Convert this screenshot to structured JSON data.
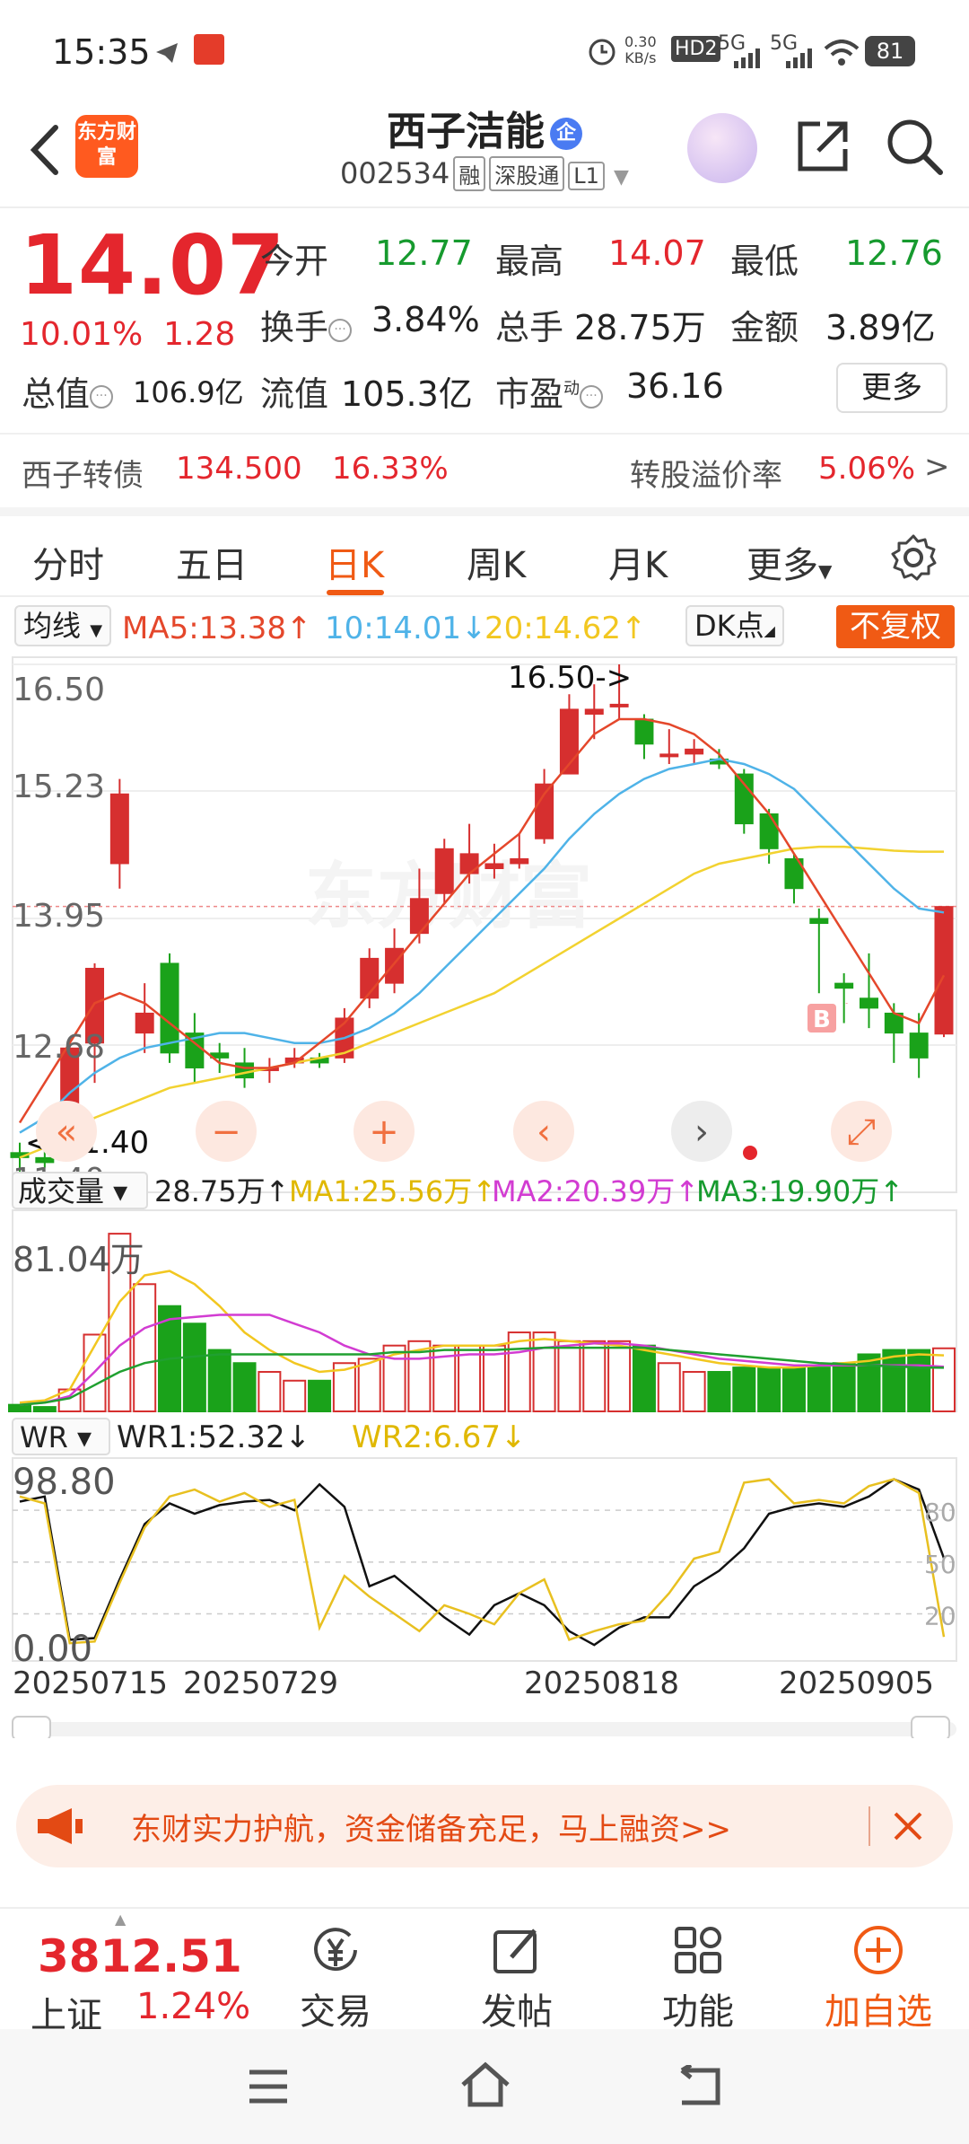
{
  "status_bar": {
    "time": "15:35",
    "net_speed_top": "0.30",
    "net_speed_unit": "KB/s",
    "hd": "HD2",
    "sig1": "5G",
    "sig2": "5G",
    "battery": "81"
  },
  "header": {
    "stock_name": "西子洁能",
    "badge": "企",
    "code": "002534",
    "tags": [
      "融",
      "深股通",
      "L1"
    ],
    "logo_text": "东方财富"
  },
  "quote": {
    "last_price": "14.07",
    "pct_change": "10.01%",
    "change": "1.28",
    "open_label": "今开",
    "open": "12.77",
    "high_label": "最高",
    "high": "14.07",
    "low_label": "最低",
    "low": "12.76",
    "turnover_label": "换手",
    "turnover": "3.84%",
    "volume_label": "总手",
    "volume": "28.75万",
    "amount_label": "金额",
    "amount": "3.89亿",
    "mktcap_label": "总值",
    "mktcap": "106.9亿",
    "float_label": "流值",
    "float_cap": "105.3亿",
    "pe_label": "市盈",
    "pe_sup": "动",
    "pe": "36.16",
    "more_label": "更多"
  },
  "convertible": {
    "name": "西子转债",
    "price": "134.500",
    "pct": "16.33%",
    "premium_label": "转股溢价率",
    "premium": "5.06%"
  },
  "tabs": [
    {
      "label": "分时",
      "active": false
    },
    {
      "label": "五日",
      "active": false
    },
    {
      "label": "日K",
      "active": true
    },
    {
      "label": "周K",
      "active": false
    },
    {
      "label": "月K",
      "active": false
    },
    {
      "label": "更多",
      "active": false
    }
  ],
  "ma_row": {
    "selector": "均线",
    "ma5": "MA5:13.38↑",
    "ma10": "10:14.01↓",
    "ma20": "20:14.62↑",
    "dk": "DK点",
    "adjust": "不复权"
  },
  "colors": {
    "ma5": "#e4472b",
    "ma10": "#4fb3e8",
    "ma20": "#f2d230",
    "up": "#d62f2f",
    "down": "#1aa21a",
    "accent": "#f05a14"
  },
  "chart_labels": {
    "price_ticks": [
      "16.50",
      "15.23",
      "13.95",
      "12.68",
      "11.40"
    ],
    "high_marker": "16.50->",
    "low_marker": "<-11.40",
    "b_marker": "B",
    "vol_selector": "成交量",
    "vol_value": "28.75万↑",
    "vol_ma1": "MA1:25.56万↑",
    "vol_ma2": "MA2:20.39万↑",
    "vol_ma3": "MA3:19.90万↑",
    "vol_tick": "81.04万",
    "wr_selector": "WR",
    "wr1": "WR1:52.32↓",
    "wr2": "WR2:6.67↓",
    "wr_ticks": [
      "98.80",
      "0.00"
    ],
    "wr_right_ticks": [
      "80",
      "50",
      "20"
    ],
    "dates": [
      "20250715",
      "20250729",
      "20250818",
      "20250905"
    ],
    "watermark": "东方财富"
  },
  "chart_data": {
    "type": "candlestick",
    "ylim": [
      11.4,
      16.5
    ],
    "candles": [
      [
        11.6,
        11.55,
        11.7,
        11.4
      ],
      [
        11.55,
        11.5,
        11.65,
        11.45
      ],
      [
        11.6,
        12.65,
        12.7,
        11.6
      ],
      [
        12.7,
        13.45,
        13.5,
        12.3
      ],
      [
        14.5,
        15.2,
        15.35,
        14.25
      ],
      [
        12.8,
        13.0,
        13.3,
        12.6
      ],
      [
        13.5,
        12.6,
        13.6,
        12.5
      ],
      [
        12.8,
        12.45,
        13.0,
        12.3
      ],
      [
        12.6,
        12.55,
        12.7,
        12.4
      ],
      [
        12.5,
        12.35,
        12.65,
        12.25
      ],
      [
        12.45,
        12.45,
        12.55,
        12.3
      ],
      [
        12.5,
        12.55,
        12.65,
        12.45
      ],
      [
        12.55,
        12.5,
        12.6,
        12.45
      ],
      [
        12.55,
        12.95,
        13.05,
        12.5
      ],
      [
        13.15,
        13.55,
        13.65,
        13.05
      ],
      [
        13.3,
        13.65,
        13.85,
        13.2
      ],
      [
        13.8,
        14.15,
        14.45,
        13.7
      ],
      [
        14.2,
        14.65,
        14.75,
        14.1
      ],
      [
        14.4,
        14.6,
        14.9,
        14.3
      ],
      [
        14.45,
        14.5,
        14.7,
        14.35
      ],
      [
        14.5,
        14.55,
        14.8,
        14.45
      ],
      [
        14.75,
        15.3,
        15.45,
        14.7
      ],
      [
        15.4,
        16.05,
        16.2,
        15.4
      ],
      [
        16.0,
        16.05,
        16.3,
        15.75
      ],
      [
        16.1,
        16.1,
        16.5,
        15.95
      ],
      [
        15.95,
        15.7,
        16.0,
        15.55
      ],
      [
        15.6,
        15.6,
        15.85,
        15.5
      ],
      [
        15.6,
        15.65,
        15.75,
        15.5
      ],
      [
        15.55,
        15.5,
        15.65,
        15.45
      ],
      [
        15.4,
        14.9,
        15.45,
        14.8
      ],
      [
        15.0,
        14.65,
        15.05,
        14.5
      ],
      [
        14.55,
        14.25,
        14.6,
        14.1
      ],
      [
        13.95,
        13.9,
        14.05,
        13.2
      ],
      [
        13.3,
        13.25,
        13.4,
        12.9
      ],
      [
        13.15,
        13.05,
        13.6,
        12.85
      ],
      [
        13.0,
        12.8,
        13.1,
        12.5
      ],
      [
        12.8,
        12.55,
        13.0,
        12.35
      ],
      [
        12.79,
        14.07,
        14.07,
        12.76
      ]
    ],
    "ma5": [
      11.9,
      12.3,
      12.7,
      13.1,
      13.2,
      13.1,
      12.9,
      12.7,
      12.5,
      12.45,
      12.45,
      12.5,
      12.7,
      12.9,
      13.2,
      13.5,
      13.8,
      14.1,
      14.4,
      14.6,
      14.8,
      15.2,
      15.5,
      15.8,
      15.95,
      15.95,
      15.9,
      15.8,
      15.6,
      15.3,
      15.0,
      14.6,
      14.2,
      13.8,
      13.4,
      13.0,
      12.9,
      13.38
    ],
    "ma10": [
      11.8,
      11.95,
      12.2,
      12.4,
      12.55,
      12.65,
      12.7,
      12.75,
      12.8,
      12.8,
      12.75,
      12.7,
      12.7,
      12.75,
      12.85,
      13.0,
      13.2,
      13.45,
      13.7,
      13.95,
      14.2,
      14.45,
      14.75,
      15.0,
      15.2,
      15.35,
      15.45,
      15.5,
      15.55,
      15.5,
      15.4,
      15.25,
      15.0,
      14.75,
      14.5,
      14.25,
      14.05,
      14.01
    ],
    "ma20": [
      11.55,
      11.65,
      11.8,
      11.95,
      12.05,
      12.15,
      12.25,
      12.3,
      12.35,
      12.4,
      12.45,
      12.5,
      12.55,
      12.6,
      12.7,
      12.8,
      12.9,
      13.0,
      13.1,
      13.2,
      13.35,
      13.5,
      13.65,
      13.8,
      13.95,
      14.1,
      14.25,
      14.4,
      14.5,
      14.55,
      14.6,
      14.65,
      14.67,
      14.67,
      14.65,
      14.63,
      14.62,
      14.62
    ],
    "volume_ylim": [
      0,
      81.04
    ],
    "volume": [
      3,
      2,
      10,
      35,
      81,
      58,
      48,
      40,
      28,
      22,
      18,
      14,
      14,
      22,
      24,
      30,
      32,
      30,
      30,
      30,
      36,
      36,
      32,
      32,
      32,
      30,
      22,
      18,
      18,
      20,
      20,
      20,
      20,
      22,
      26,
      28,
      28,
      28.75
    ],
    "vol_ma1": [
      4,
      5,
      10,
      30,
      50,
      62,
      64,
      58,
      48,
      36,
      28,
      22,
      18,
      19,
      22,
      26,
      28,
      30,
      30,
      30,
      32,
      33,
      32,
      31,
      30,
      28,
      26,
      24,
      22,
      21,
      20,
      20,
      21,
      22,
      23,
      25,
      26,
      25.56
    ],
    "vol_ma2": [
      3,
      4,
      7,
      18,
      30,
      38,
      42,
      43,
      44,
      44,
      44,
      40,
      36,
      30,
      26,
      24,
      24,
      25,
      26,
      26,
      27,
      29,
      30,
      31,
      31,
      30,
      28,
      26,
      24,
      23,
      22,
      21,
      21,
      21,
      21,
      21,
      21,
      20.39
    ],
    "vol_ma3": [
      3,
      4,
      6,
      12,
      18,
      22,
      24,
      25,
      26,
      26,
      26,
      26,
      26,
      26,
      26,
      27,
      27,
      28,
      28,
      28,
      28.5,
      29,
      29,
      29,
      29,
      29,
      28,
      27,
      26,
      25,
      24,
      23,
      22,
      21.5,
      21,
      20.5,
      20,
      19.9
    ],
    "wr_ylim": [
      0,
      98.8
    ],
    "wr1": [
      85,
      88,
      5,
      6,
      40,
      72,
      84,
      78,
      83,
      85,
      86,
      80,
      95,
      82,
      36,
      42,
      30,
      18,
      8,
      25,
      32,
      25,
      10,
      2,
      12,
      18,
      18,
      36,
      45,
      58,
      78,
      82,
      84,
      82,
      88,
      98,
      92,
      52.32
    ],
    "wr2": [
      88,
      84,
      3,
      4,
      38,
      70,
      88,
      92,
      85,
      90,
      82,
      86,
      12,
      42,
      30,
      20,
      10,
      25,
      20,
      14,
      32,
      40,
      5,
      10,
      14,
      16,
      32,
      52,
      56,
      96,
      98,
      84,
      86,
      84,
      94,
      98,
      90,
      6.67
    ]
  },
  "promo": {
    "text": "东财实力护航，资金储备充足，马上融资>>"
  },
  "toolbar": {
    "index_value": "3812.51",
    "index_name": "上证",
    "index_pct": "1.24%",
    "items": [
      "交易",
      "发帖",
      "功能",
      "加自选"
    ]
  }
}
